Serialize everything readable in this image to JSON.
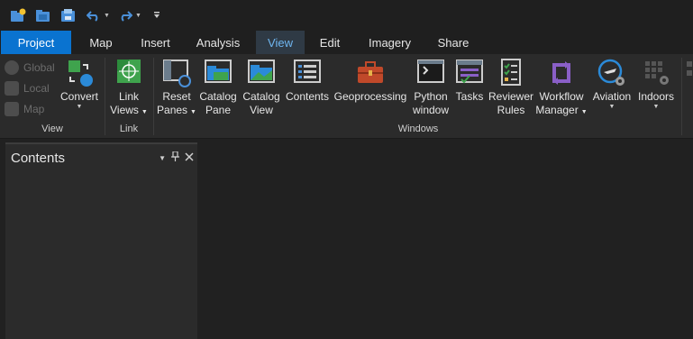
{
  "tabs": [
    {
      "label": "Project"
    },
    {
      "label": "Map"
    },
    {
      "label": "Insert"
    },
    {
      "label": "Analysis"
    },
    {
      "label": "View",
      "active": true
    },
    {
      "label": "Edit"
    },
    {
      "label": "Imagery"
    },
    {
      "label": "Share"
    }
  ],
  "ribbon": {
    "view_group": {
      "label": "View",
      "small_buttons": [
        "Global",
        "Local",
        "Map"
      ],
      "convert_label": "Convert"
    },
    "link_group": {
      "label": "Link",
      "link_views_line1": "Link",
      "link_views_line2": "Views"
    },
    "windows_group": {
      "label": "Windows",
      "buttons": [
        {
          "line1": "Reset",
          "line2": "Panes",
          "icon": "reset-panes-icon",
          "dropdown": true
        },
        {
          "line1": "Catalog",
          "line2": "Pane",
          "icon": "catalog-pane-icon"
        },
        {
          "line1": "Catalog",
          "line2": "View",
          "icon": "catalog-view-icon"
        },
        {
          "line1": "Contents",
          "line2": "",
          "icon": "contents-icon"
        },
        {
          "line1": "Geoprocessing",
          "line2": "",
          "icon": "toolbox-icon"
        },
        {
          "line1": "Python",
          "line2": "window",
          "icon": "python-window-icon"
        },
        {
          "line1": "Tasks",
          "line2": "",
          "icon": "tasks-icon"
        },
        {
          "line1": "Reviewer",
          "line2": "Rules",
          "icon": "reviewer-rules-icon"
        },
        {
          "line1": "Workflow",
          "line2": "Manager",
          "icon": "workflow-manager-icon",
          "dropdown": true
        },
        {
          "line1": "Aviation",
          "line2": "",
          "icon": "aviation-icon",
          "dropdown": true
        },
        {
          "line1": "Indoors",
          "line2": "",
          "icon": "indoors-icon",
          "dropdown": true
        }
      ]
    }
  },
  "contents_pane": {
    "title": "Contents"
  },
  "colors": {
    "accent": "#0a73d0",
    "active_tab_text": "#6fb6f0",
    "ribbon_bg": "#2b2b2b",
    "app_bg": "#212121"
  }
}
